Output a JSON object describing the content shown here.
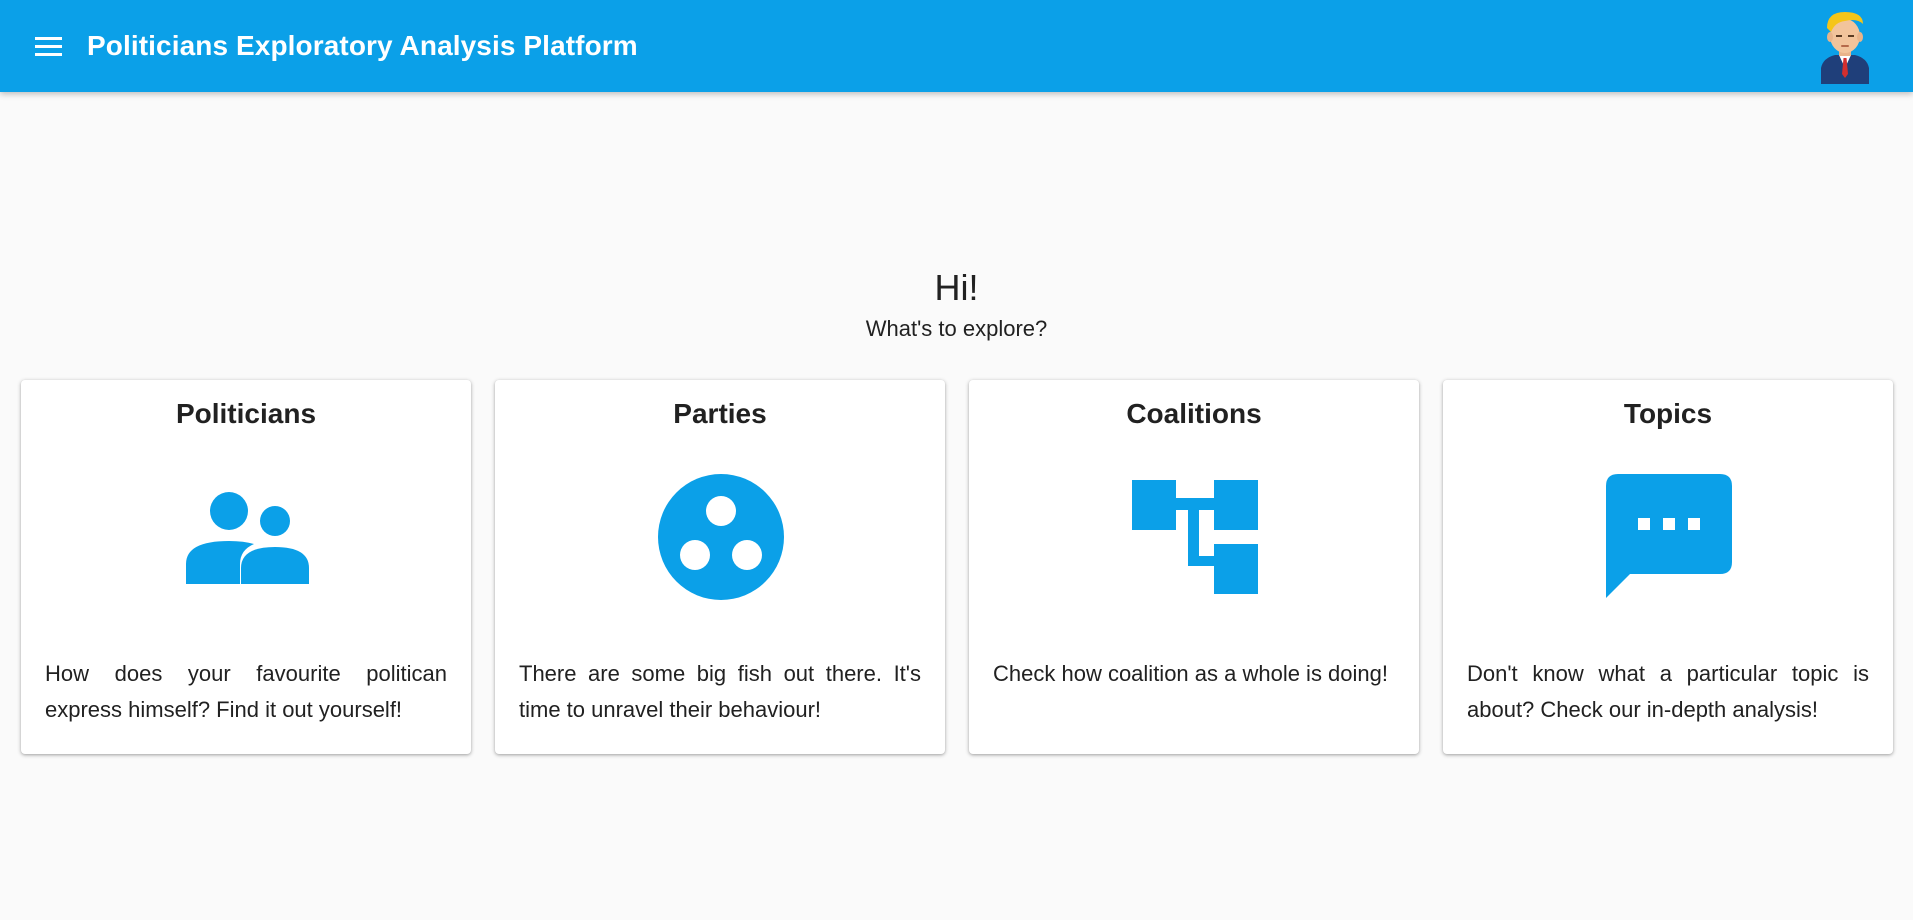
{
  "header": {
    "title": "Politicians Exploratory Analysis Platform",
    "menu_icon": "menu-icon",
    "avatar_icon": "politician-avatar-icon",
    "color": "#0ba0e8"
  },
  "hero": {
    "title": "Hi!",
    "subtitle": "What's to explore?"
  },
  "cards": [
    {
      "title": "Politicians",
      "icon": "people-icon",
      "description": "How does your favourite politican express himself? Find it out yourself!"
    },
    {
      "title": "Parties",
      "icon": "group-circle-icon",
      "description": "There are some big fish out there. It's time to unravel their behaviour!"
    },
    {
      "title": "Coalitions",
      "icon": "account-tree-icon",
      "description": "Check how coalition as a whole is doing!"
    },
    {
      "title": "Topics",
      "icon": "chat-bubble-icon",
      "description": "Don't know what a particular topic is about? Check our in-depth analysis!"
    }
  ],
  "colors": {
    "accent": "#0ba0e8",
    "background": "#fafafa",
    "card": "#ffffff"
  }
}
